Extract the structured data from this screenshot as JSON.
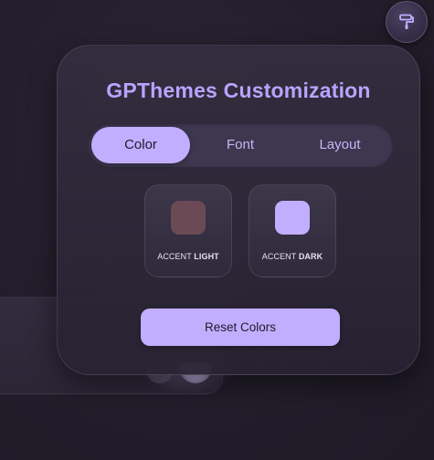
{
  "panel": {
    "title": "GPThemes Customization"
  },
  "tabs": [
    {
      "label": "Color",
      "active": true
    },
    {
      "label": "Font",
      "active": false
    },
    {
      "label": "Layout",
      "active": false
    }
  ],
  "swatches": [
    {
      "label_prefix": "ACCENT ",
      "label_emphasis": "LIGHT",
      "color": "#6b4a56"
    },
    {
      "label_prefix": "ACCENT ",
      "label_emphasis": "DARK",
      "color": "#c2aeff"
    }
  ],
  "actions": {
    "reset_label": "Reset Colors"
  },
  "toggle_button": {
    "icon": "paint-roller-icon"
  },
  "colors": {
    "accent": "#c2aeff",
    "title": "#b9a3ff",
    "background": "#211d2a",
    "panel": "#342e40"
  }
}
